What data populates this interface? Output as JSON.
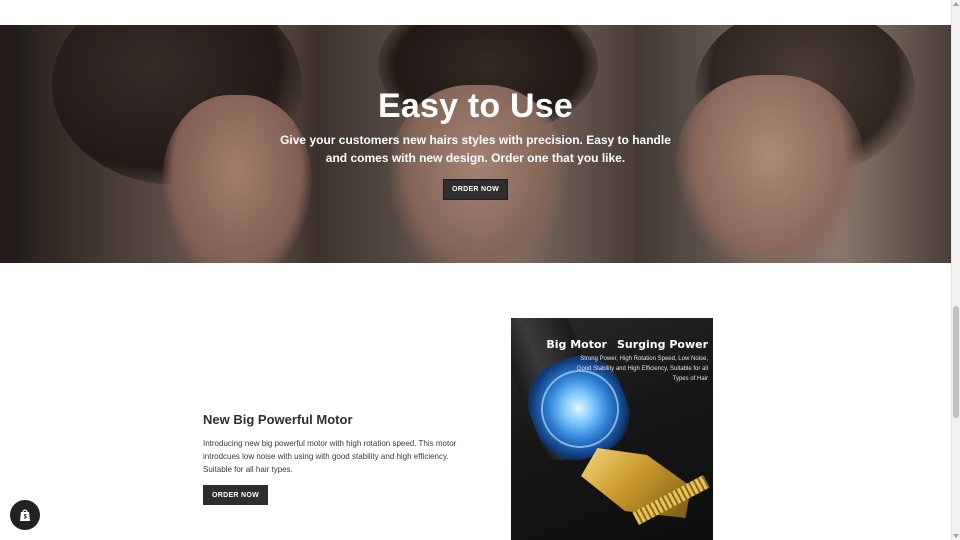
{
  "hero": {
    "title": "Easy to Use",
    "subtitle": "Give your customers new hairs styles with precision. Easy to handle and comes with new design. Order one that you like.",
    "button_label": "ORDER NOW"
  },
  "feature": {
    "title": "New Big Powerful Motor",
    "text": "Introducing new big powerful motor with high rotation speed. This motor introdcues low noise with using with good stability and high efficiency. Suitable for all hair types.",
    "button_label": "ORDER NOW"
  },
  "product_image": {
    "heading_left": "Big Motor",
    "heading_right": "Surging Power",
    "description": "Strong Power, High Rotation Speed, Low Noise, Good Stability and High Efficiency, Suitable for all Types of Hair"
  },
  "icons": {
    "shop_badge": "shopify-bag-icon"
  },
  "colors": {
    "button_bg": "#2e2e2e",
    "button_text": "#ffffff",
    "hero_text": "#ffffff",
    "body_text": "#3a3a3a"
  }
}
